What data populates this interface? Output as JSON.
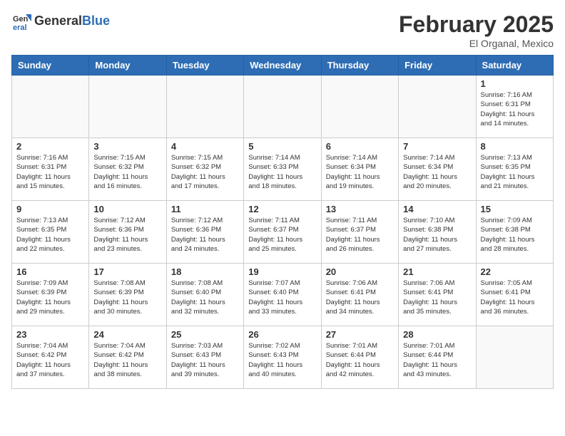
{
  "header": {
    "logo_general": "General",
    "logo_blue": "Blue",
    "month_title": "February 2025",
    "location": "El Organal, Mexico"
  },
  "weekdays": [
    "Sunday",
    "Monday",
    "Tuesday",
    "Wednesday",
    "Thursday",
    "Friday",
    "Saturday"
  ],
  "weeks": [
    [
      {
        "day": "",
        "info": ""
      },
      {
        "day": "",
        "info": ""
      },
      {
        "day": "",
        "info": ""
      },
      {
        "day": "",
        "info": ""
      },
      {
        "day": "",
        "info": ""
      },
      {
        "day": "",
        "info": ""
      },
      {
        "day": "1",
        "info": "Sunrise: 7:16 AM\nSunset: 6:31 PM\nDaylight: 11 hours\nand 14 minutes."
      }
    ],
    [
      {
        "day": "2",
        "info": "Sunrise: 7:16 AM\nSunset: 6:31 PM\nDaylight: 11 hours\nand 15 minutes."
      },
      {
        "day": "3",
        "info": "Sunrise: 7:15 AM\nSunset: 6:32 PM\nDaylight: 11 hours\nand 16 minutes."
      },
      {
        "day": "4",
        "info": "Sunrise: 7:15 AM\nSunset: 6:32 PM\nDaylight: 11 hours\nand 17 minutes."
      },
      {
        "day": "5",
        "info": "Sunrise: 7:14 AM\nSunset: 6:33 PM\nDaylight: 11 hours\nand 18 minutes."
      },
      {
        "day": "6",
        "info": "Sunrise: 7:14 AM\nSunset: 6:34 PM\nDaylight: 11 hours\nand 19 minutes."
      },
      {
        "day": "7",
        "info": "Sunrise: 7:14 AM\nSunset: 6:34 PM\nDaylight: 11 hours\nand 20 minutes."
      },
      {
        "day": "8",
        "info": "Sunrise: 7:13 AM\nSunset: 6:35 PM\nDaylight: 11 hours\nand 21 minutes."
      }
    ],
    [
      {
        "day": "9",
        "info": "Sunrise: 7:13 AM\nSunset: 6:35 PM\nDaylight: 11 hours\nand 22 minutes."
      },
      {
        "day": "10",
        "info": "Sunrise: 7:12 AM\nSunset: 6:36 PM\nDaylight: 11 hours\nand 23 minutes."
      },
      {
        "day": "11",
        "info": "Sunrise: 7:12 AM\nSunset: 6:36 PM\nDaylight: 11 hours\nand 24 minutes."
      },
      {
        "day": "12",
        "info": "Sunrise: 7:11 AM\nSunset: 6:37 PM\nDaylight: 11 hours\nand 25 minutes."
      },
      {
        "day": "13",
        "info": "Sunrise: 7:11 AM\nSunset: 6:37 PM\nDaylight: 11 hours\nand 26 minutes."
      },
      {
        "day": "14",
        "info": "Sunrise: 7:10 AM\nSunset: 6:38 PM\nDaylight: 11 hours\nand 27 minutes."
      },
      {
        "day": "15",
        "info": "Sunrise: 7:09 AM\nSunset: 6:38 PM\nDaylight: 11 hours\nand 28 minutes."
      }
    ],
    [
      {
        "day": "16",
        "info": "Sunrise: 7:09 AM\nSunset: 6:39 PM\nDaylight: 11 hours\nand 29 minutes."
      },
      {
        "day": "17",
        "info": "Sunrise: 7:08 AM\nSunset: 6:39 PM\nDaylight: 11 hours\nand 30 minutes."
      },
      {
        "day": "18",
        "info": "Sunrise: 7:08 AM\nSunset: 6:40 PM\nDaylight: 11 hours\nand 32 minutes."
      },
      {
        "day": "19",
        "info": "Sunrise: 7:07 AM\nSunset: 6:40 PM\nDaylight: 11 hours\nand 33 minutes."
      },
      {
        "day": "20",
        "info": "Sunrise: 7:06 AM\nSunset: 6:41 PM\nDaylight: 11 hours\nand 34 minutes."
      },
      {
        "day": "21",
        "info": "Sunrise: 7:06 AM\nSunset: 6:41 PM\nDaylight: 11 hours\nand 35 minutes."
      },
      {
        "day": "22",
        "info": "Sunrise: 7:05 AM\nSunset: 6:41 PM\nDaylight: 11 hours\nand 36 minutes."
      }
    ],
    [
      {
        "day": "23",
        "info": "Sunrise: 7:04 AM\nSunset: 6:42 PM\nDaylight: 11 hours\nand 37 minutes."
      },
      {
        "day": "24",
        "info": "Sunrise: 7:04 AM\nSunset: 6:42 PM\nDaylight: 11 hours\nand 38 minutes."
      },
      {
        "day": "25",
        "info": "Sunrise: 7:03 AM\nSunset: 6:43 PM\nDaylight: 11 hours\nand 39 minutes."
      },
      {
        "day": "26",
        "info": "Sunrise: 7:02 AM\nSunset: 6:43 PM\nDaylight: 11 hours\nand 40 minutes."
      },
      {
        "day": "27",
        "info": "Sunrise: 7:01 AM\nSunset: 6:44 PM\nDaylight: 11 hours\nand 42 minutes."
      },
      {
        "day": "28",
        "info": "Sunrise: 7:01 AM\nSunset: 6:44 PM\nDaylight: 11 hours\nand 43 minutes."
      },
      {
        "day": "",
        "info": ""
      }
    ]
  ]
}
